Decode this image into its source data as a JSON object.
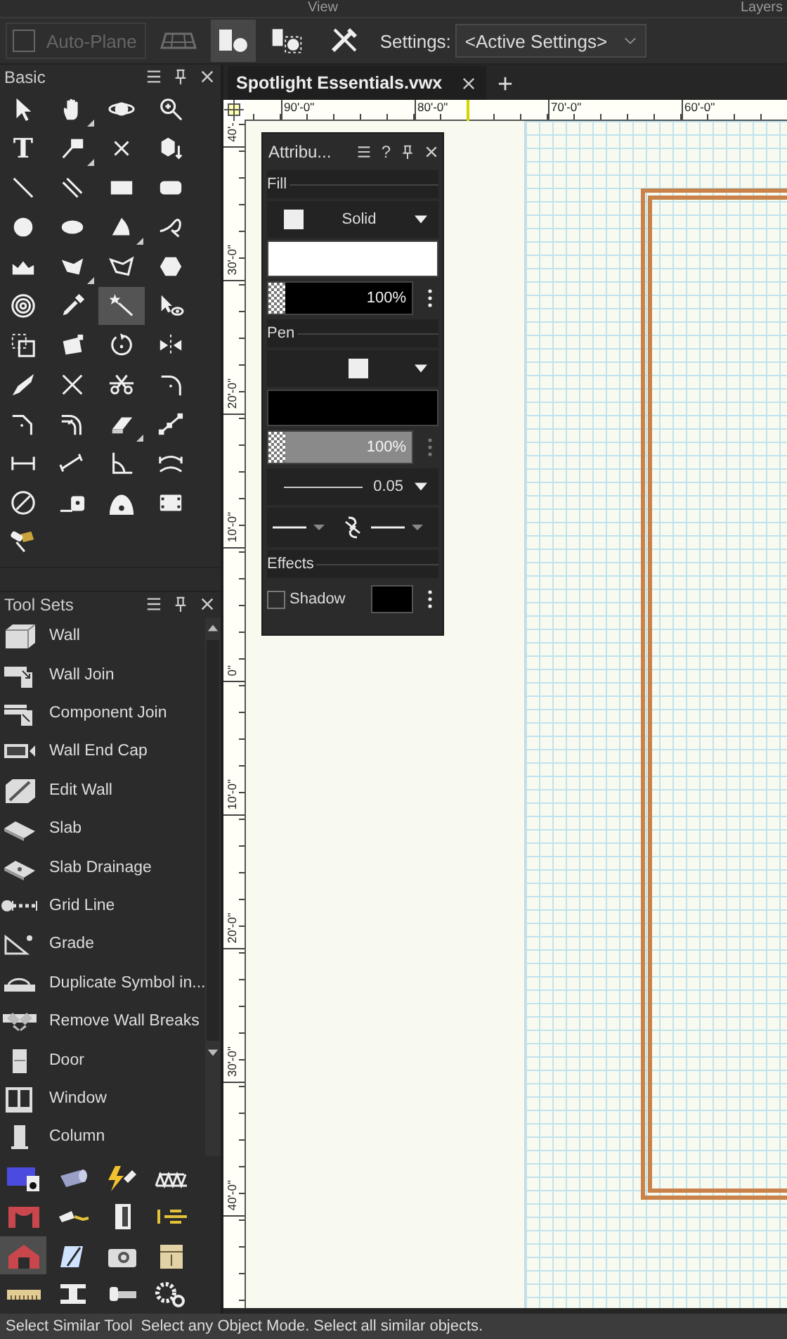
{
  "top_strip": [
    {
      "text": "View"
    },
    {
      "text": "Layers"
    }
  ],
  "toolbar": {
    "auto_plane": {
      "label": "Auto-Plane",
      "checked": false,
      "disabled": true
    },
    "modes": [
      {
        "selected": true
      },
      {
        "selected": false
      }
    ],
    "settings_label": "Settings:",
    "settings_value": "<Active Settings>"
  },
  "basic": {
    "title": "Basic",
    "tools": [
      {
        "selected": false,
        "flyout": false
      },
      {
        "selected": false,
        "flyout": true
      },
      {
        "selected": false,
        "flyout": false
      },
      {
        "selected": false,
        "flyout": false
      },
      {
        "selected": false,
        "flyout": false,
        "glyph": "T"
      },
      {
        "selected": false,
        "flyout": true
      },
      {
        "selected": false,
        "flyout": false
      },
      {
        "selected": false,
        "flyout": false
      },
      {
        "selected": false,
        "flyout": false
      },
      {
        "selected": false,
        "flyout": false
      },
      {
        "selected": false,
        "flyout": false
      },
      {
        "selected": false,
        "flyout": false
      },
      {
        "selected": false,
        "flyout": false
      },
      {
        "selected": false,
        "flyout": false
      },
      {
        "selected": false,
        "flyout": true
      },
      {
        "selected": false,
        "flyout": false
      },
      {
        "selected": false,
        "flyout": false
      },
      {
        "selected": false,
        "flyout": true
      },
      {
        "selected": false,
        "flyout": false
      },
      {
        "selected": false,
        "flyout": false
      },
      {
        "selected": false,
        "flyout": false
      },
      {
        "selected": false,
        "flyout": false
      },
      {
        "selected": true,
        "flyout": false
      },
      {
        "selected": false,
        "flyout": false
      },
      {
        "selected": false,
        "flyout": false
      },
      {
        "selected": false,
        "flyout": false
      },
      {
        "selected": false,
        "flyout": false
      },
      {
        "selected": false,
        "flyout": false
      },
      {
        "selected": false,
        "flyout": false
      },
      {
        "selected": false,
        "flyout": false
      },
      {
        "selected": false,
        "flyout": false
      },
      {
        "selected": false,
        "flyout": false
      },
      {
        "selected": false,
        "flyout": false
      },
      {
        "selected": false,
        "flyout": false
      },
      {
        "selected": false,
        "flyout": true
      },
      {
        "selected": false,
        "flyout": false
      },
      {
        "selected": false,
        "flyout": false
      },
      {
        "selected": false,
        "flyout": false
      },
      {
        "selected": false,
        "flyout": false
      },
      {
        "selected": false,
        "flyout": false
      },
      {
        "selected": false,
        "flyout": false
      },
      {
        "selected": false,
        "flyout": false
      },
      {
        "selected": false,
        "flyout": false
      },
      {
        "selected": false,
        "flyout": false
      },
      {
        "selected": false,
        "flyout": false
      }
    ]
  },
  "tool_sets": {
    "title": "Tool Sets",
    "items": [
      {
        "label": "Wall"
      },
      {
        "label": "Wall Join"
      },
      {
        "label": "Component Join"
      },
      {
        "label": "Wall End Cap"
      },
      {
        "label": "Edit Wall"
      },
      {
        "label": "Slab"
      },
      {
        "label": "Slab Drainage"
      },
      {
        "label": "Grid Line"
      },
      {
        "label": "Grade"
      },
      {
        "label": "Duplicate Symbol in..."
      },
      {
        "label": "Remove Wall Breaks"
      },
      {
        "label": "Door"
      },
      {
        "label": "Window"
      },
      {
        "label": "Column"
      }
    ],
    "sets": [
      {
        "selected": false
      },
      {
        "selected": false
      },
      {
        "selected": false
      },
      {
        "selected": false
      },
      {
        "selected": false
      },
      {
        "selected": false
      },
      {
        "selected": false
      },
      {
        "selected": false
      },
      {
        "selected": true
      },
      {
        "selected": false
      },
      {
        "selected": false
      },
      {
        "selected": false
      },
      {
        "selected": false
      },
      {
        "selected": false
      },
      {
        "selected": false
      },
      {
        "selected": false
      }
    ]
  },
  "document_tabs": [
    {
      "label": "Spotlight Essentials.vwx",
      "selected": true
    }
  ],
  "rulers": {
    "horizontal": [
      "90'-0\"",
      "80'-0\"",
      "70'-0\"",
      "60'-0\""
    ],
    "vertical": [
      "40'-",
      "30'-0\"",
      "20'-0\"",
      "10'-0\"",
      "0\"",
      "10'-0\"",
      "20'-0\"",
      "30'-0\"",
      "40'-0\""
    ]
  },
  "attributes": {
    "title": "Attribu...",
    "help": "?",
    "fill": {
      "label": "Fill",
      "style": "Solid",
      "opacity": "100%"
    },
    "pen": {
      "label": "Pen",
      "opacity": "100%",
      "thickness": "0.05"
    },
    "effects": {
      "label": "Effects",
      "shadow": {
        "label": "Shadow",
        "checked": false
      }
    }
  },
  "status_bar": {
    "tool": "Select Similar Tool",
    "hint": "Select any Object Mode. Select all similar objects."
  }
}
